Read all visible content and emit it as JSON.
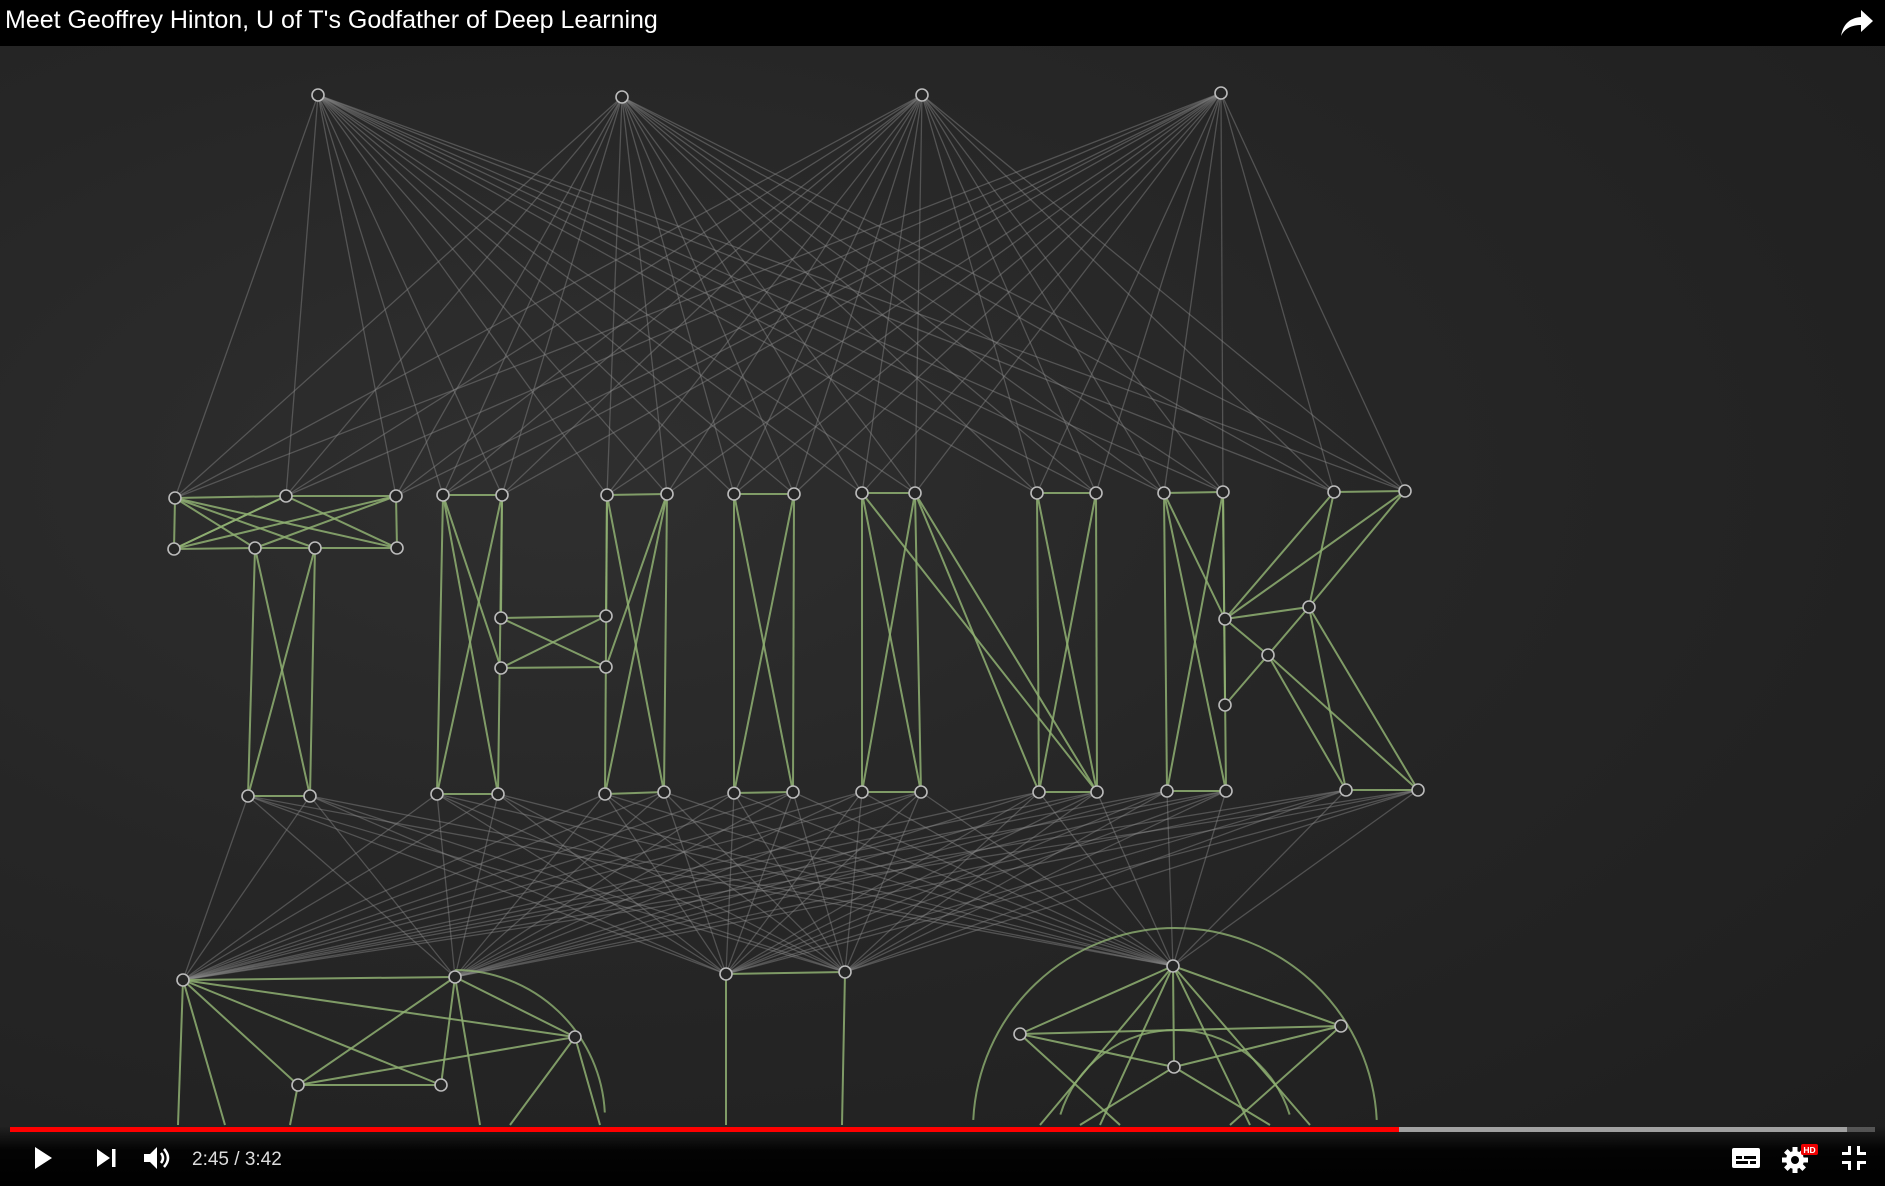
{
  "video": {
    "title": "Meet Geoffrey Hinton, U of T's Godfather of Deep Learning",
    "scene_text": "THINK",
    "colors": {
      "green": "#8fb072",
      "grey": "#8a8a8a",
      "progress_played": "#ff0000"
    }
  },
  "controls": {
    "current_time": "2:45",
    "separator": " / ",
    "duration": "3:42",
    "played_fraction": 0.7448,
    "loaded_fraction": 0.985,
    "hd_badge": "HD"
  },
  "icons": [
    "share-icon",
    "play-icon",
    "next-icon",
    "volume-icon",
    "subtitles-icon",
    "settings-icon",
    "exit-fullscreen-icon"
  ]
}
